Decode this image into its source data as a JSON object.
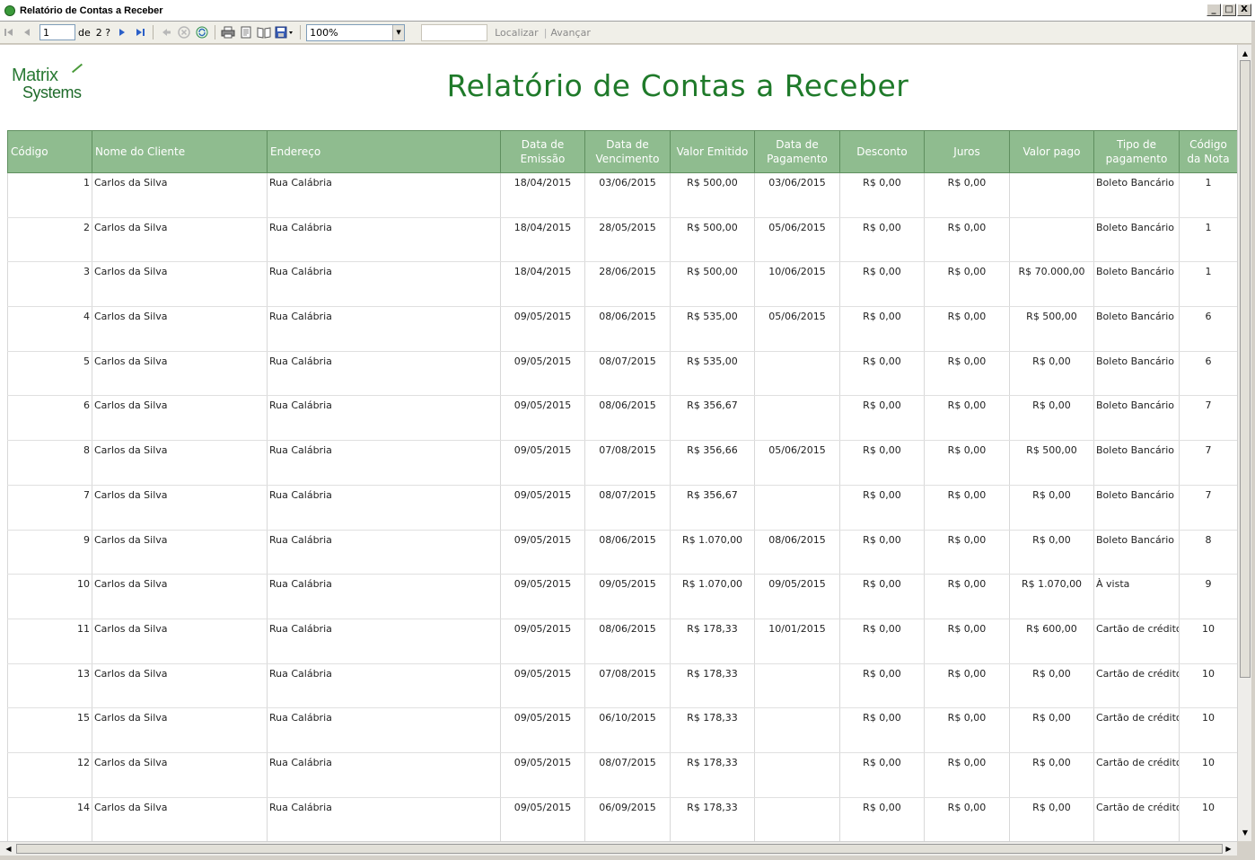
{
  "window": {
    "title": "Relatório de Contas a Receber",
    "buttons": [
      "_",
      "□",
      "X"
    ]
  },
  "toolbar": {
    "page_value": "1",
    "of_label": "de",
    "page_count": "2 ?",
    "zoom_value": "100%",
    "find_placeholder": "",
    "find_label": "Localizar",
    "next_label": "Avançar"
  },
  "report": {
    "title": "Relatório de Contas a Receber",
    "logo_line1": "Matrix",
    "logo_line2": "Systems",
    "columns": [
      "Código",
      "Nome do Cliente",
      "Endereço",
      "Data de Emissão",
      "Data de Vencimento",
      "Valor Emitido",
      "Data de Pagamento",
      "Desconto",
      "Juros",
      "Valor pago",
      "Tipo de pagamento",
      "Código da Nota"
    ],
    "rows": [
      [
        "1",
        "Carlos da Silva",
        "Rua Calábria",
        "18/04/2015",
        "03/06/2015",
        "R$ 500,00",
        "03/06/2015",
        "R$ 0,00",
        "R$ 0,00",
        "",
        "Boleto Bancário",
        "1"
      ],
      [
        "2",
        "Carlos da Silva",
        "Rua Calábria",
        "18/04/2015",
        "28/05/2015",
        "R$ 500,00",
        "05/06/2015",
        "R$ 0,00",
        "R$ 0,00",
        "",
        "Boleto Bancário",
        "1"
      ],
      [
        "3",
        "Carlos da Silva",
        "Rua Calábria",
        "18/04/2015",
        "28/06/2015",
        "R$ 500,00",
        "10/06/2015",
        "R$ 0,00",
        "R$ 0,00",
        "R$ 70.000,00",
        "Boleto Bancário",
        "1"
      ],
      [
        "4",
        "Carlos da Silva",
        "Rua Calábria",
        "09/05/2015",
        "08/06/2015",
        "R$ 535,00",
        "05/06/2015",
        "R$ 0,00",
        "R$ 0,00",
        "R$ 500,00",
        "Boleto Bancário",
        "6"
      ],
      [
        "5",
        "Carlos da Silva",
        "Rua Calábria",
        "09/05/2015",
        "08/07/2015",
        "R$ 535,00",
        "",
        "R$ 0,00",
        "R$ 0,00",
        "R$ 0,00",
        "Boleto Bancário",
        "6"
      ],
      [
        "6",
        "Carlos da Silva",
        "Rua Calábria",
        "09/05/2015",
        "08/06/2015",
        "R$ 356,67",
        "",
        "R$ 0,00",
        "R$ 0,00",
        "R$ 0,00",
        "Boleto Bancário",
        "7"
      ],
      [
        "8",
        "Carlos da Silva",
        "Rua Calábria",
        "09/05/2015",
        "07/08/2015",
        "R$ 356,66",
        "05/06/2015",
        "R$ 0,00",
        "R$ 0,00",
        "R$ 500,00",
        "Boleto Bancário",
        "7"
      ],
      [
        "7",
        "Carlos da Silva",
        "Rua Calábria",
        "09/05/2015",
        "08/07/2015",
        "R$ 356,67",
        "",
        "R$ 0,00",
        "R$ 0,00",
        "R$ 0,00",
        "Boleto Bancário",
        "7"
      ],
      [
        "9",
        "Carlos da Silva",
        "Rua Calábria",
        "09/05/2015",
        "08/06/2015",
        "R$ 1.070,00",
        "08/06/2015",
        "R$ 0,00",
        "R$ 0,00",
        "R$ 0,00",
        "Boleto Bancário",
        "8"
      ],
      [
        "10",
        "Carlos da Silva",
        "Rua Calábria",
        "09/05/2015",
        "09/05/2015",
        "R$ 1.070,00",
        "09/05/2015",
        "R$ 0,00",
        "R$ 0,00",
        "R$ 1.070,00",
        "À vista",
        "9"
      ],
      [
        "11",
        "Carlos da Silva",
        "Rua Calábria",
        "09/05/2015",
        "08/06/2015",
        "R$ 178,33",
        "10/01/2015",
        "R$ 0,00",
        "R$ 0,00",
        "R$ 600,00",
        "Cartão de crédito",
        "10"
      ],
      [
        "13",
        "Carlos da Silva",
        "Rua Calábria",
        "09/05/2015",
        "07/08/2015",
        "R$ 178,33",
        "",
        "R$ 0,00",
        "R$ 0,00",
        "R$ 0,00",
        "Cartão de crédito",
        "10"
      ],
      [
        "15",
        "Carlos da Silva",
        "Rua Calábria",
        "09/05/2015",
        "06/10/2015",
        "R$ 178,33",
        "",
        "R$ 0,00",
        "R$ 0,00",
        "R$ 0,00",
        "Cartão de crédito",
        "10"
      ],
      [
        "12",
        "Carlos da Silva",
        "Rua Calábria",
        "09/05/2015",
        "08/07/2015",
        "R$ 178,33",
        "",
        "R$ 0,00",
        "R$ 0,00",
        "R$ 0,00",
        "Cartão de crédito",
        "10"
      ],
      [
        "14",
        "Carlos da Silva",
        "Rua Calábria",
        "09/05/2015",
        "06/09/2015",
        "R$ 178,33",
        "",
        "R$ 0,00",
        "R$ 0,00",
        "R$ 0,00",
        "Cartão de crédito",
        "10"
      ]
    ]
  },
  "colors": {
    "header_bg": "#8fbc8f",
    "title_green": "#1f7a2a"
  }
}
